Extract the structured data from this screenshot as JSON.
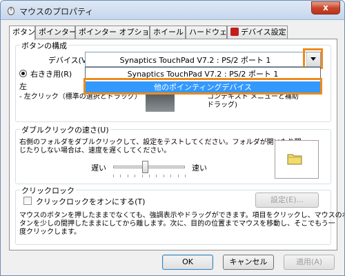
{
  "window": {
    "title": "マウスのプロパティ",
    "close_label": "x"
  },
  "tabs": [
    {
      "label": "ボタン"
    },
    {
      "label": "ポインター"
    },
    {
      "label": "ポインター オプション"
    },
    {
      "label": "ホイール"
    },
    {
      "label": "ハードウェア"
    },
    {
      "label": "デバイス設定"
    }
  ],
  "button_config": {
    "group_label": "ボタンの構成",
    "device_label": "デバイス(V):",
    "device_value": "Synaptics TouchPad V7.2 : PS/2 ポート 1",
    "dropdown_options": [
      "Synaptics TouchPad V7.2 : PS/2 ポート 1",
      "他のポインティングデバイス"
    ],
    "right_handed_label": "右きき用(R)",
    "left_label": "左",
    "left_click_desc": "- 左クリック（標準の選択とドラッグ）",
    "right_click_desc_1": "コンテキスト メニューと補助",
    "right_click_desc_2": "ドラッグ)"
  },
  "double_click": {
    "group_label": "ダブルクリックの速さ(U)",
    "desc_line1": "右側のフォルダをダブルクリックして、設定をテストしてください。フォルダが開いたり閉",
    "desc_line2": "じたりしない場合は、速度を遅くしてください。",
    "slow_label": "遅い",
    "fast_label": "速い",
    "speed_fraction": 0.45
  },
  "click_lock": {
    "group_label": "クリックロック",
    "checkbox_label": "クリックロックをオンにする(T)",
    "settings_button": "設定(E)...",
    "desc_line1": "マウスのボタンを押したままでなくても、強調表示やドラッグができます。項目をクリックし、マウスのボ",
    "desc_line2": "タンを少しの間押したままにしてから離します。次に、目的の位置までマウスを移動し、そこでもう一",
    "desc_line3": "度クリックします。"
  },
  "footer": {
    "ok": "OK",
    "cancel": "キャンセル",
    "apply": "適用(A)"
  },
  "colors": {
    "highlight_outline": "#ef8a1a",
    "selection": "#3399ff"
  }
}
